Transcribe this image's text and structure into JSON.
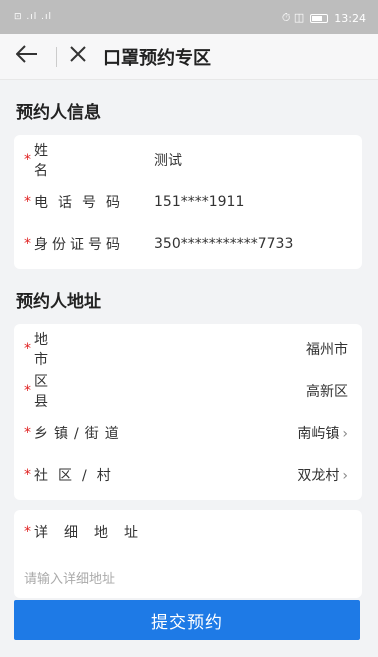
{
  "status_bar": {
    "left": "⊡ .ıl .ıl",
    "right_icons": "⏱ ◫",
    "time": "13:24"
  },
  "nav": {
    "back_icon": "arrow-left-icon",
    "close_icon": "close-icon",
    "title": "口罩预约专区"
  },
  "applicant_info": {
    "title": "预约人信息",
    "rows": [
      {
        "label": "姓名",
        "value": "测试"
      },
      {
        "label": "电话号码",
        "value": "151****1911"
      },
      {
        "label": "身份证号码",
        "value": "350***********7733"
      }
    ]
  },
  "applicant_address": {
    "title": "预约人地址",
    "rows": [
      {
        "label": "地市",
        "value": "福州市",
        "chevron": false
      },
      {
        "label": "区县",
        "value": "高新区",
        "chevron": false
      },
      {
        "label": "乡镇/街道",
        "value": "南屿镇",
        "chevron": true
      },
      {
        "label": "社区/村",
        "value": "双龙村",
        "chevron": true
      }
    ]
  },
  "detail_address": {
    "label": "详细地址",
    "placeholder": "请输入详细地址"
  },
  "submit_label": "提交预约",
  "colors": {
    "primary": "#1e7ae6",
    "required": "#e02020",
    "background": "#f2f3f5"
  }
}
